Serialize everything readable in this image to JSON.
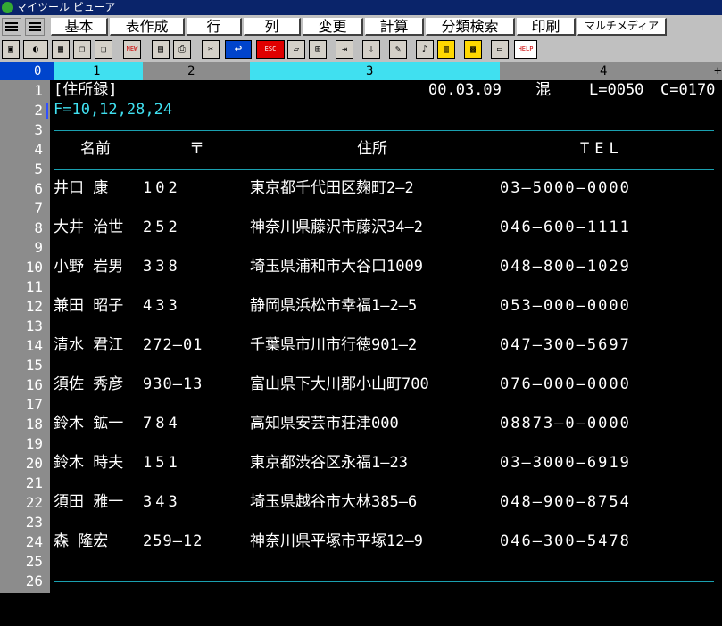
{
  "window": {
    "title": "マイツール ビューア"
  },
  "menu": {
    "items": [
      "基本",
      "表作成",
      "行",
      "列",
      "変更",
      "計算",
      "分類検索",
      "印刷",
      "マルチメディア"
    ]
  },
  "toolbar": {
    "icons": [
      "window-icon",
      "palette-icon",
      "calculator-icon",
      "copy-icon",
      "paste-icon",
      "new-badge-icon",
      "print-preview-icon",
      "printer-icon",
      "scissors-icon",
      "return-icon",
      "escape-icon",
      "notebook-icon",
      "table-icon",
      "insert-row-icon",
      "insert-col-icon",
      "pen-icon",
      "speaker-icon",
      "book-icon",
      "chart-icon",
      "monitor-icon",
      "help-icon"
    ],
    "labels": {
      "escape": "ESC",
      "help": "HELP",
      "new": "NEW",
      "return": "↩"
    }
  },
  "ruler": {
    "labels": [
      "0",
      "1",
      "2",
      "3",
      "4",
      "+"
    ]
  },
  "header": {
    "title": "[住所録]",
    "date": "00.03.09",
    "mode": "混",
    "line": "L=0050",
    "column": "C=0170",
    "format": "F=10,12,28,24"
  },
  "columns": [
    "名前",
    "〒",
    "住所",
    "TEL"
  ],
  "records": [
    {
      "name": "井口 康",
      "zip": "102",
      "address": "東京都千代田区麹町2—2",
      "tel": "03—5000—0000"
    },
    {
      "name": "大井 治世",
      "zip": "252",
      "address": "神奈川県藤沢市藤沢34—2",
      "tel": "046—600—1111"
    },
    {
      "name": "小野 岩男",
      "zip": "338",
      "address": "埼玉県浦和市大谷口1009",
      "tel": "048—800—1029"
    },
    {
      "name": "兼田 昭子",
      "zip": "433",
      "address": "静岡県浜松市幸福1—2—5",
      "tel": "053—000—0000"
    },
    {
      "name": "清水 君江",
      "zip": "272—01",
      "address": "千葉県市川市行徳901—2",
      "tel": "047—300—5697"
    },
    {
      "name": "須佐 秀彦",
      "zip": "930—13",
      "address": "富山県下大川郡小山町700",
      "tel": "076—000—0000"
    },
    {
      "name": "鈴木 鉱一",
      "zip": "784",
      "address": "高知県安芸市荘津000",
      "tel": "08873—0—0000"
    },
    {
      "name": "鈴木 時夫",
      "zip": "151",
      "address": "東京都渋谷区永福1—23",
      "tel": "03—3000—6919"
    },
    {
      "name": "須田 雅一",
      "zip": "343",
      "address": "埼玉県越谷市大林385—6",
      "tel": "048—900—8754"
    },
    {
      "name": "森 隆宏",
      "zip": "259—12",
      "address": "神奈川県平塚市平塚12—9",
      "tel": "046—300—5478"
    }
  ],
  "line_numbers": [
    "1",
    "2",
    "3",
    "4",
    "5",
    "6",
    "7",
    "8",
    "9",
    "10",
    "11",
    "12",
    "13",
    "14",
    "15",
    "16",
    "17",
    "18",
    "19",
    "20",
    "21",
    "22",
    "23",
    "24",
    "25",
    "26"
  ]
}
